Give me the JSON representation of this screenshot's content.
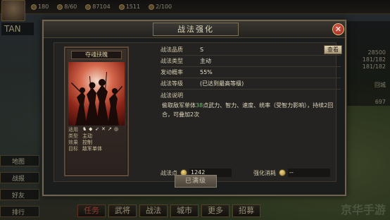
{
  "top_bar": {
    "resources": [
      "180",
      "8/60",
      "87104",
      "1511",
      "2/100"
    ]
  },
  "left_hud": {
    "name": "TAN",
    "panels": [
      "地图",
      "战报",
      "好友",
      "排行"
    ]
  },
  "right_hud": {
    "values": [
      "28500",
      "181/182",
      "181/182",
      "回城",
      "697"
    ]
  },
  "bottom_nav": {
    "task": "任务",
    "general": "武将",
    "tactic": "战法",
    "city": "城市",
    "more": "更多",
    "recruit": "招募"
  },
  "watermark": "京华手游",
  "dialog": {
    "title": "战法强化",
    "close": "✕",
    "card": {
      "title": "夺魂挟魄",
      "use_label": "适用",
      "type_label": "类型",
      "type_value": "主动",
      "effect_label": "效果",
      "effect_value": "控制",
      "target_label": "目标",
      "target_value": "敌军单体"
    },
    "attributes": [
      {
        "key": "战法品质",
        "value": "S"
      },
      {
        "key": "战法类型",
        "value": "主动"
      },
      {
        "key": "发动概率",
        "value": "55%"
      },
      {
        "key": "战法等级",
        "value": "(已达到最高等级)"
      }
    ],
    "change_button": "查看",
    "desc_title": "战法说明",
    "desc_pre": "偷取敌军单体",
    "desc_highlight": "38",
    "desc_post": "点武力、智力、速度、统率（受智力影响），持续2回合，可叠加2次",
    "points_label": "战法点",
    "points_value": "1242",
    "cost_label": "强化消耗",
    "cost_value": "--",
    "action_button": "已满级"
  }
}
